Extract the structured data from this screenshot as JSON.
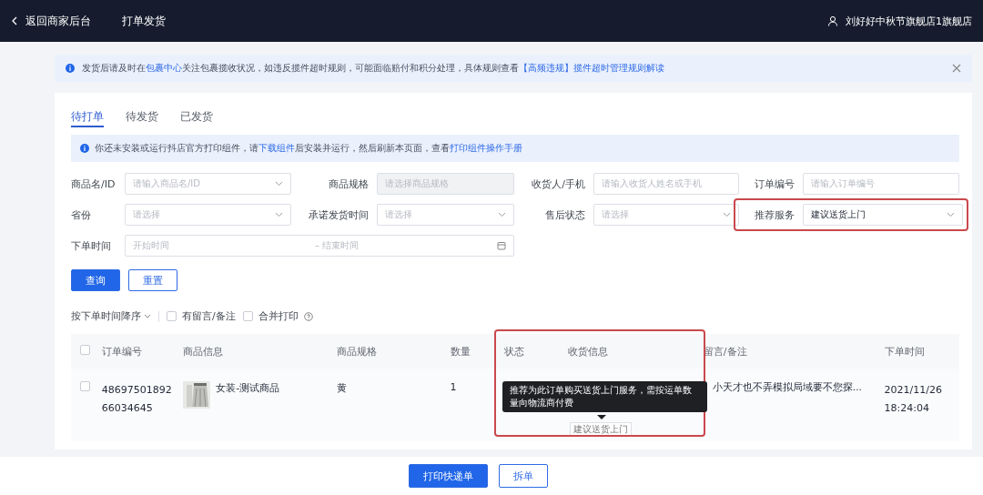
{
  "topbar": {
    "back_label": "返回商家后台",
    "page_title": "打单发货",
    "user": "刘好好中秋节旗舰店1旗舰店"
  },
  "notice": {
    "segments": [
      {
        "text": "发货后请及时在",
        "link": false
      },
      {
        "text": "包裹中心",
        "link": true
      },
      {
        "text": "关注包裹揽收状况，如违反揽件超时规则，可能面临赔付和积分处理，具体规则查看",
        "link": false
      },
      {
        "text": "【高频违规】揽件超时管理规则解读",
        "link": true
      }
    ]
  },
  "tabs": [
    {
      "label": "待打单",
      "selected": true
    },
    {
      "label": "待发货",
      "selected": false
    },
    {
      "label": "已发货",
      "selected": false
    }
  ],
  "install_notice": {
    "segments": [
      {
        "text": "你还未安装或运行抖店官方打印组件，请",
        "link": false
      },
      {
        "text": "下载组件",
        "link": true
      },
      {
        "text": "后安装并运行，然后刷新本页面，查看",
        "link": false
      },
      {
        "text": "打印组件操作手册",
        "link": true
      }
    ]
  },
  "filters": [
    {
      "label": "商品名/ID",
      "kind": "select",
      "placeholder": "请输入商品名/ID",
      "highlighted": false
    },
    {
      "label": "商品规格",
      "kind": "disabled",
      "placeholder": "请选择商品规格",
      "highlighted": false
    },
    {
      "label": "收货人/手机",
      "kind": "input",
      "placeholder": "请输入收货人姓名或手机",
      "highlighted": false
    },
    {
      "label": "订单编号",
      "kind": "input",
      "placeholder": "请输入订单编号",
      "highlighted": false
    },
    {
      "label": "省份",
      "kind": "select",
      "placeholder": "请选择",
      "highlighted": false
    },
    {
      "label": "承诺发货时间",
      "kind": "select",
      "placeholder": "请选择",
      "highlighted": false
    },
    {
      "label": "售后状态",
      "kind": "select",
      "placeholder": "请选择",
      "highlighted": false
    },
    {
      "label": "推荐服务",
      "kind": "select",
      "value": "建议送货上门",
      "highlighted": true
    },
    {
      "label": "下单时间",
      "kind": "daterange",
      "start_placeholder": "开始时间",
      "separator": "–",
      "end_placeholder": "结束时间",
      "highlighted": false
    }
  ],
  "form_buttons": [
    {
      "label": "查询",
      "kind": "primary"
    },
    {
      "label": "重置",
      "kind": "outline"
    }
  ],
  "sort": {
    "label": "按下单时间降序",
    "options": [
      {
        "label": "有留言/备注",
        "checked": false,
        "help": false
      },
      {
        "label": "合并打印",
        "checked": false,
        "help": true
      }
    ]
  },
  "table": {
    "all_checked": false,
    "columns": [
      {
        "label": "订单编号",
        "highlighted": false
      },
      {
        "label": "商品信息",
        "highlighted": false
      },
      {
        "label": "商品规格",
        "highlighted": false
      },
      {
        "label": "数量",
        "highlighted": false
      },
      {
        "label": "状态",
        "highlighted": true
      },
      {
        "label": "收货信息",
        "highlighted": true
      },
      {
        "label": "留言/备注",
        "highlighted": false
      },
      {
        "label": "下单时间",
        "highlighted": false
      }
    ],
    "rows": [
      {
        "checked": false,
        "order_no": "4869750189266034645",
        "product": "女装-测试商品",
        "spec": "黄",
        "quantity": "1",
        "service_tag": "建议送货上门",
        "remark": "小天才也不弄模拟局域要不您探...",
        "time": "2021/11/26 18:24:04"
      }
    ],
    "tooltip": "推荐为此订单购买送货上门服务，需按运单数量向物流商付费"
  },
  "actions": [
    {
      "label": "打印快递单",
      "kind": "primary"
    },
    {
      "label": "拆单",
      "kind": "outline"
    }
  ]
}
